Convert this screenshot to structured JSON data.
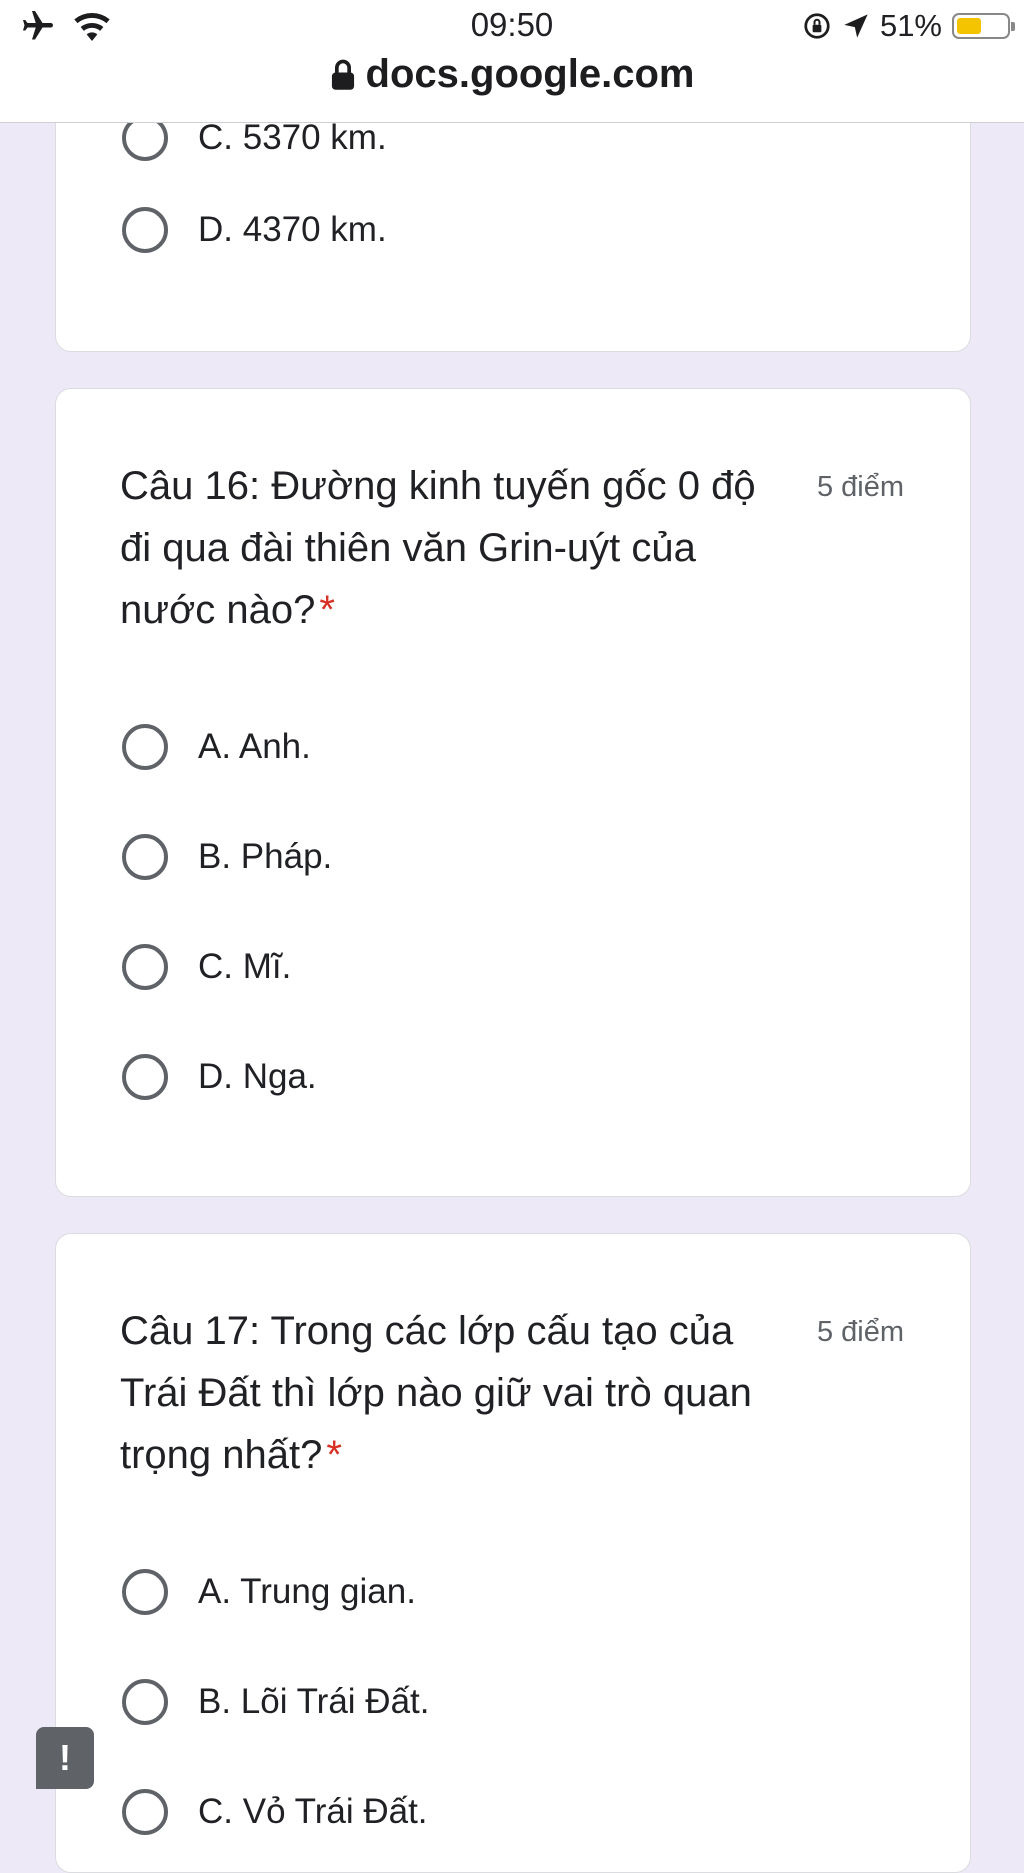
{
  "status": {
    "time": "09:50",
    "battery": "51%",
    "battery_level": 0.51
  },
  "url": {
    "domain": "docs.google.com"
  },
  "questions": [
    {
      "options": [
        {
          "label": "C. 5370 km."
        },
        {
          "label": "D. 4370 km."
        }
      ]
    },
    {
      "title": "Câu 16: Đường kinh tuyến gốc 0 độ đi qua đài thiên văn Grin-uýt của nước nào?",
      "points": "5 điểm",
      "required": "*",
      "options": [
        {
          "label": "A. Anh."
        },
        {
          "label": "B. Pháp."
        },
        {
          "label": "C. Mĩ."
        },
        {
          "label": "D. Nga."
        }
      ]
    },
    {
      "title": "Câu 17: Trong các lớp cấu tạo của Trái Đất thì lớp nào giữ vai trò quan trọng nhất?",
      "points": "5 điểm",
      "required": "*",
      "options": [
        {
          "label": "A. Trung gian."
        },
        {
          "label": "B. Lõi Trái Đất."
        },
        {
          "label": "C. Vỏ Trái Đất."
        }
      ]
    }
  ],
  "report_button": {
    "label": "!"
  },
  "colors": {
    "background": "#ede9f7",
    "required": "#d93025",
    "radio": "#5f6368",
    "battery": "#f5c400"
  }
}
